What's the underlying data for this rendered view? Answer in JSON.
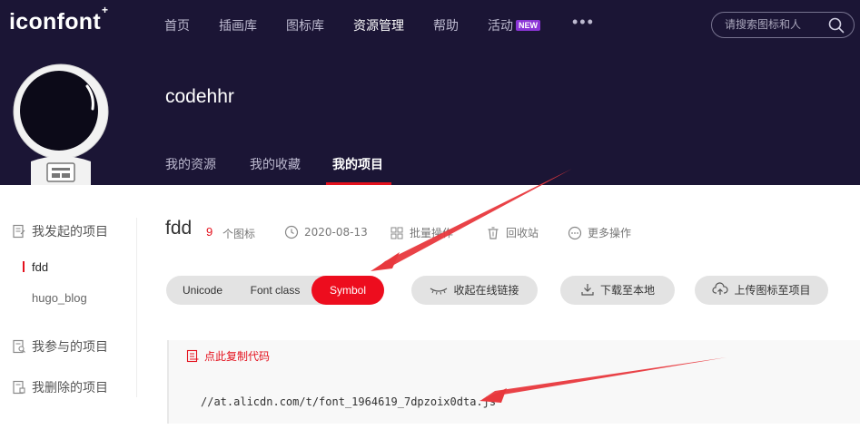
{
  "header": {
    "logo": "iconfont",
    "logo_mark": "+",
    "nav": [
      "首页",
      "插画库",
      "图标库",
      "资源管理",
      "帮助",
      "活动"
    ],
    "new_badge": "NEW",
    "more": "•••",
    "search_placeholder": "请搜索图标和人"
  },
  "profile": {
    "username": "codehhr",
    "tabs": [
      "我的资源",
      "我的收藏",
      "我的项目"
    ],
    "active_tab": "我的项目"
  },
  "sidebar": {
    "sections": [
      {
        "label": "我发起的项目",
        "items": [
          "fdd",
          "hugo_blog"
        ]
      },
      {
        "label": "我参与的项目"
      },
      {
        "label": "我删除的项目"
      }
    ],
    "active_item": "fdd"
  },
  "project": {
    "name": "fdd",
    "icon_count": "9",
    "icon_count_label": "个图标",
    "date": "2020-08-13",
    "batch_label": "批量操作",
    "recycle_label": "回收站",
    "more_label": "更多操作"
  },
  "tabs": {
    "items": [
      "Unicode",
      "Font class",
      "Symbol"
    ],
    "active": "Symbol"
  },
  "actions": {
    "collapse_link": "收起在线链接",
    "download": "下载至本地",
    "upload": "上传图标至项目"
  },
  "code": {
    "copy_label": "点此复制代码",
    "url": "//at.alicdn.com/t/font_1964619_7dpzoix0dta.js"
  },
  "colors": {
    "header_bg": "#1b1535",
    "accent": "#e4111d",
    "active_tab_bg": "#ed0d1e",
    "new_badge": "#8b35d6",
    "arrow": "#e8383d"
  },
  "icons": [
    "search-icon",
    "clock-icon",
    "grid-icon",
    "trash-icon",
    "more-circle-icon",
    "link-icon",
    "download-icon",
    "upload-cloud-icon",
    "copy-icon",
    "project-doc-icon"
  ]
}
